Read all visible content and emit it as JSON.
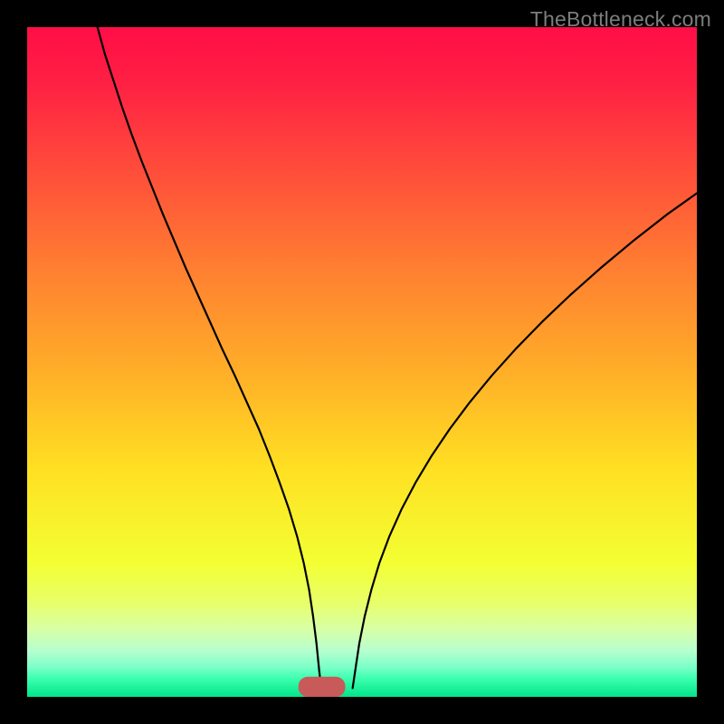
{
  "watermark": {
    "text": "TheBottleneck.com"
  },
  "chart_data": {
    "type": "line",
    "title": "",
    "xlabel": "",
    "ylabel": "",
    "xlim": [
      0,
      100
    ],
    "ylim": [
      0,
      100
    ],
    "grid": false,
    "gradient_stops": [
      {
        "offset": 0,
        "color": "#ff0e46"
      },
      {
        "offset": 0.08,
        "color": "#ff1f44"
      },
      {
        "offset": 0.22,
        "color": "#ff4f3a"
      },
      {
        "offset": 0.38,
        "color": "#ff8530"
      },
      {
        "offset": 0.52,
        "color": "#ffb028"
      },
      {
        "offset": 0.66,
        "color": "#ffe022"
      },
      {
        "offset": 0.8,
        "color": "#f3ff33"
      },
      {
        "offset": 0.86,
        "color": "#e8ff6a"
      },
      {
        "offset": 0.9,
        "color": "#d7ffa8"
      },
      {
        "offset": 0.93,
        "color": "#b8ffce"
      },
      {
        "offset": 0.955,
        "color": "#7dffc9"
      },
      {
        "offset": 0.972,
        "color": "#3effb0"
      },
      {
        "offset": 1.0,
        "color": "#00e58a"
      }
    ],
    "marker": {
      "x": 44,
      "y": 98.5,
      "w": 7,
      "h": 3,
      "rx": 1.4,
      "fill": "#c85a5a"
    },
    "series": [
      {
        "name": "left-curve",
        "stroke": "#000000",
        "stroke_width": 2.2,
        "points": [
          {
            "x": 10.5,
            "y": 0
          },
          {
            "x": 11.6,
            "y": 4
          },
          {
            "x": 12.9,
            "y": 8
          },
          {
            "x": 14.2,
            "y": 12
          },
          {
            "x": 15.6,
            "y": 16
          },
          {
            "x": 17.1,
            "y": 20
          },
          {
            "x": 18.7,
            "y": 24
          },
          {
            "x": 20.3,
            "y": 28
          },
          {
            "x": 22.0,
            "y": 32
          },
          {
            "x": 23.7,
            "y": 36
          },
          {
            "x": 25.5,
            "y": 40
          },
          {
            "x": 27.3,
            "y": 44
          },
          {
            "x": 29.1,
            "y": 48
          },
          {
            "x": 31.0,
            "y": 52
          },
          {
            "x": 32.8,
            "y": 56
          },
          {
            "x": 34.6,
            "y": 60
          },
          {
            "x": 36.2,
            "y": 64
          },
          {
            "x": 37.7,
            "y": 68
          },
          {
            "x": 39.1,
            "y": 72
          },
          {
            "x": 40.3,
            "y": 76
          },
          {
            "x": 41.3,
            "y": 80
          },
          {
            "x": 42.1,
            "y": 84
          },
          {
            "x": 42.7,
            "y": 88
          },
          {
            "x": 43.2,
            "y": 92
          },
          {
            "x": 43.6,
            "y": 96
          },
          {
            "x": 43.9,
            "y": 98.7
          }
        ]
      },
      {
        "name": "right-curve",
        "stroke": "#000000",
        "stroke_width": 2.2,
        "points": [
          {
            "x": 48.6,
            "y": 98.7
          },
          {
            "x": 49.0,
            "y": 96
          },
          {
            "x": 49.6,
            "y": 92
          },
          {
            "x": 50.4,
            "y": 88
          },
          {
            "x": 51.4,
            "y": 84
          },
          {
            "x": 52.6,
            "y": 80
          },
          {
            "x": 54.1,
            "y": 76
          },
          {
            "x": 55.9,
            "y": 72
          },
          {
            "x": 58.0,
            "y": 68
          },
          {
            "x": 60.4,
            "y": 64
          },
          {
            "x": 63.1,
            "y": 60
          },
          {
            "x": 66.1,
            "y": 56
          },
          {
            "x": 69.4,
            "y": 52
          },
          {
            "x": 73.0,
            "y": 48
          },
          {
            "x": 76.9,
            "y": 44
          },
          {
            "x": 81.1,
            "y": 40
          },
          {
            "x": 85.6,
            "y": 36
          },
          {
            "x": 90.4,
            "y": 32
          },
          {
            "x": 95.5,
            "y": 28
          },
          {
            "x": 100.0,
            "y": 24.8
          }
        ]
      }
    ]
  }
}
